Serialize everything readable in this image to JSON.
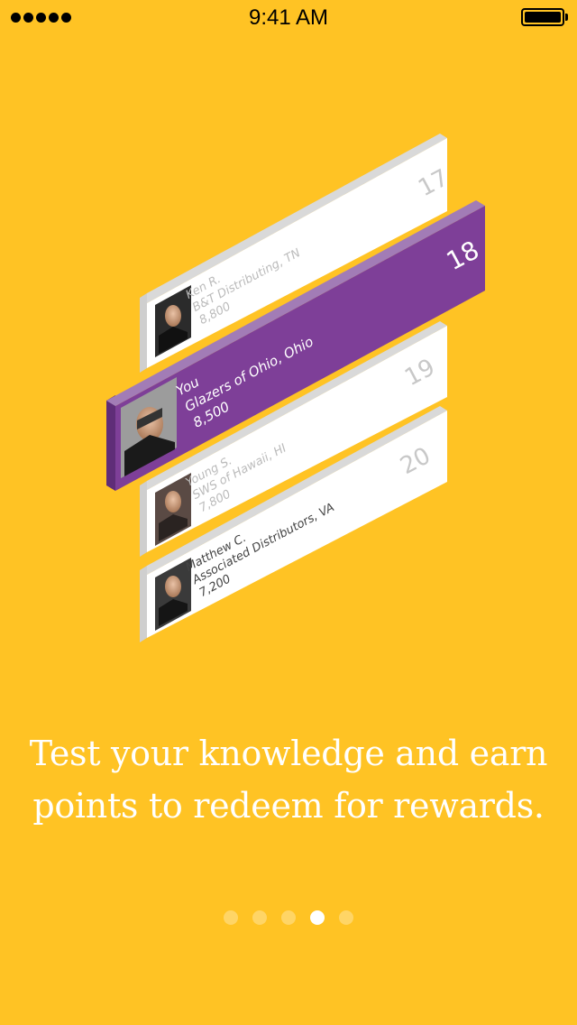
{
  "status_bar": {
    "time": "9:41 AM",
    "signal_dots": 5
  },
  "leaderboard": [
    {
      "rank": "17",
      "name": "Ken R.",
      "company": "B&T Distributing, TN",
      "points": "8,800",
      "highlight": false
    },
    {
      "rank": "18",
      "name": "You",
      "company": "Glazers of Ohio, Ohio",
      "points": "8,500",
      "highlight": true
    },
    {
      "rank": "19",
      "name": "Young S.",
      "company": "SWS of Hawaii, HI",
      "points": "7,800",
      "highlight": false
    },
    {
      "rank": "20",
      "name": "Matthew C.",
      "company": "Associated Distributors, VA",
      "points": "7,200",
      "highlight": false
    }
  ],
  "tagline": {
    "line1": "Test your knowledge and earn",
    "line2": "points to redeem for rewards."
  },
  "pager": {
    "count": 5,
    "active_index": 3
  },
  "colors": {
    "background": "#FFC324",
    "highlight": "#7E3F98",
    "card": "#FFFFFF"
  }
}
